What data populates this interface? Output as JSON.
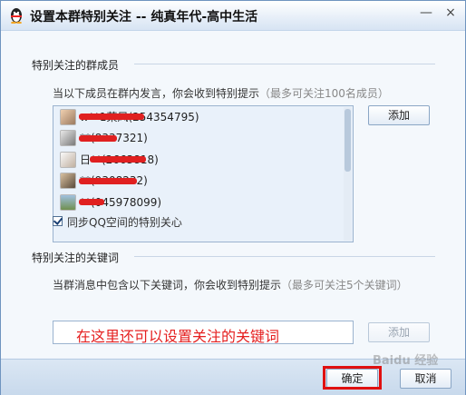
{
  "window": {
    "title": "设置本群特别关注 -- 纯真年代-高中生活",
    "minimize_glyph": "—",
    "close_glyph": "×"
  },
  "members_section": {
    "label": "特别关注的群成员",
    "hint": "当以下成员在群内发言，你会收到特别提示",
    "hint_gray": "（最多可关注100名成员）",
    "add_label": "添加",
    "members": [
      {
        "name": "w**1莱风(254354795)"
      },
      {
        "name": "**(8337321)"
      },
      {
        "name": "日**(2663818)"
      },
      {
        "name": "**(9308232)"
      },
      {
        "name": "**(045978099)"
      }
    ],
    "sync_label": "同步QQ空间的特别关心",
    "sync_checked": true
  },
  "keywords_section": {
    "label": "特别关注的关键词",
    "hint": "当群消息中包含以下关键词，你会收到特别提示",
    "hint_gray": "（最多可关注5个关键词）",
    "input_value": "在这里还可以设置关注的关键词",
    "add_label": "添加"
  },
  "footer": {
    "ok_label": "确定",
    "cancel_label": "取消",
    "watermark": "Baidu 经验"
  },
  "colors": {
    "annotation_red": "#e01010",
    "window_bg": "#eef4fb",
    "border": "#6f94bf"
  }
}
